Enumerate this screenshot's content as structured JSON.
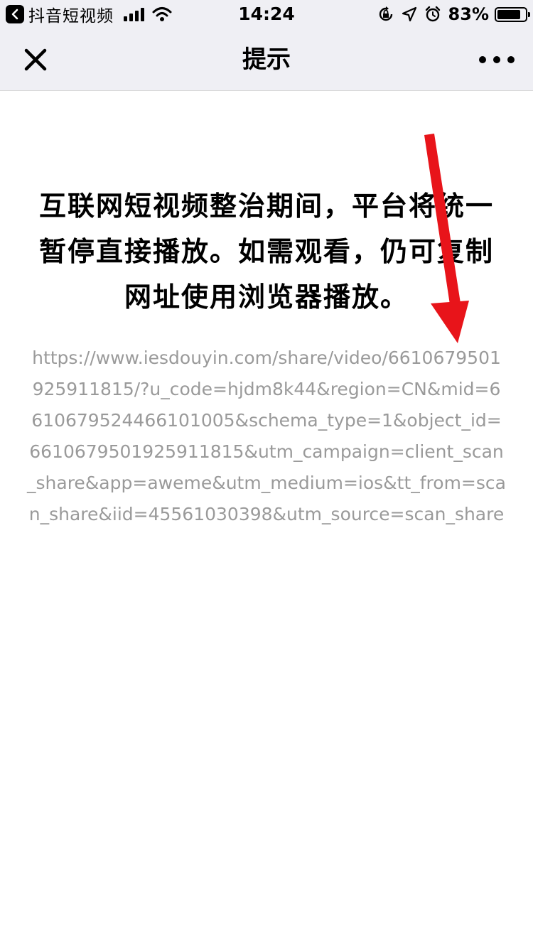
{
  "status_bar": {
    "back_app": "抖音短视频",
    "time": "14:24",
    "battery_percent": "83%",
    "battery_level": 0.83
  },
  "nav": {
    "title": "提示",
    "close_icon": "close-icon",
    "more_icon": "more-icon"
  },
  "content": {
    "notice": "互联网短视频整治期间，平台将统一暂停直接播放。如需观看，仍可复制网址使用浏览器播放。",
    "url": "https://www.iesdouyin.com/share/video/6610679501925911815/?u_code=hjdm8k44&region=CN&mid=6610679524466101005&schema_type=1&object_id=6610679501925911815&utm_campaign=client_scan_share&app=aweme&utm_medium=ios&tt_from=scan_share&iid=45561030398&utm_source=scan_share"
  },
  "annotation": {
    "arrow_color": "#e8141a"
  }
}
